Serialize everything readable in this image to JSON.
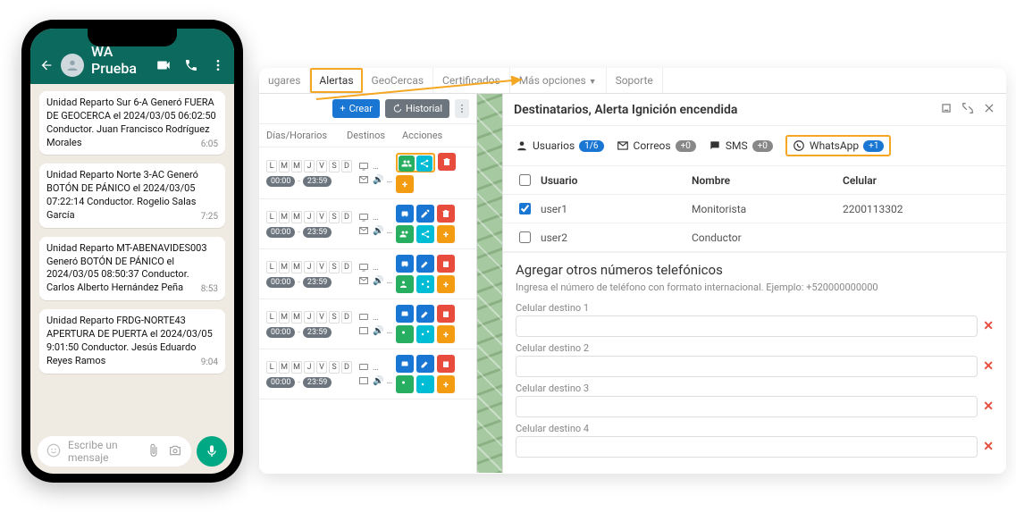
{
  "phone": {
    "contact_name": "WA Prueba",
    "input_placeholder": "Escribe un mensaje",
    "messages": [
      {
        "text": "Unidad Reparto Sur 6-A Generó FUERA DE GEOCERCA el 2024/03/05 06:02:50 Conductor. Juan Francisco Rodríguez Morales",
        "time": "6:05"
      },
      {
        "text": "Unidad Reparto Norte 3-AC Generó BOTÓN DE PÁNICO el 2024/03/05 07:22:14 Conductor. Rogelio Salas García",
        "time": "7:25"
      },
      {
        "text": "Unidad Reparto MT-ABENAVIDES003 Generó BOTÓN DE PÁNICO el 2024/03/05 08:50:37 Conductor. Carlos Alberto Hernández Peña",
        "time": "8:53"
      },
      {
        "text": "Unidad Reparto FRDG-NORTE43 APERTURA DE PUERTA el 2024/03/05 9:01:50 Conductor. Jesús Eduardo Reyes Ramos",
        "time": "9:04"
      }
    ]
  },
  "tabs": {
    "lugares": "ugares",
    "alertas": "Alertas",
    "geocercas": "GeoCercas",
    "certificados": "Certificados",
    "mas_opciones": "Más opciones",
    "soporte": "Soporte"
  },
  "toolbar": {
    "crear": "Crear",
    "historial": "Historial"
  },
  "table_head": {
    "dias": "Días/Horarios",
    "destinos": "Destinos",
    "acciones": "Acciones"
  },
  "days_labels": [
    "L",
    "M",
    "M",
    "J",
    "V",
    "S",
    "D"
  ],
  "time_from": "00:00",
  "time_to": "23:59",
  "recipients": {
    "title": "Destinatarios, Alerta Ignición encendida",
    "tabs": {
      "usuarios": "Usuarios",
      "usuarios_badge": "1/6",
      "correos": "Correos",
      "correos_badge": "+0",
      "sms": "SMS",
      "sms_badge": "+0",
      "whatsapp": "WhatsApp",
      "whatsapp_badge": "+1"
    },
    "head": {
      "usuario": "Usuario",
      "nombre": "Nombre",
      "celular": "Celular"
    },
    "rows": [
      {
        "checked": true,
        "usuario": "user1",
        "nombre": "Monitorista",
        "celular": "2200113302"
      },
      {
        "checked": false,
        "usuario": "user2",
        "nombre": "Conductor",
        "celular": ""
      }
    ],
    "add": {
      "title": "Agregar otros números telefónicos",
      "hint": "Ingresa el número de teléfono con formato internacional. Ejemplo: +520000000000",
      "label1": "Celular destino 1",
      "label2": "Celular destino 2",
      "label3": "Celular destino 3",
      "label4": "Celular destino 4"
    }
  }
}
